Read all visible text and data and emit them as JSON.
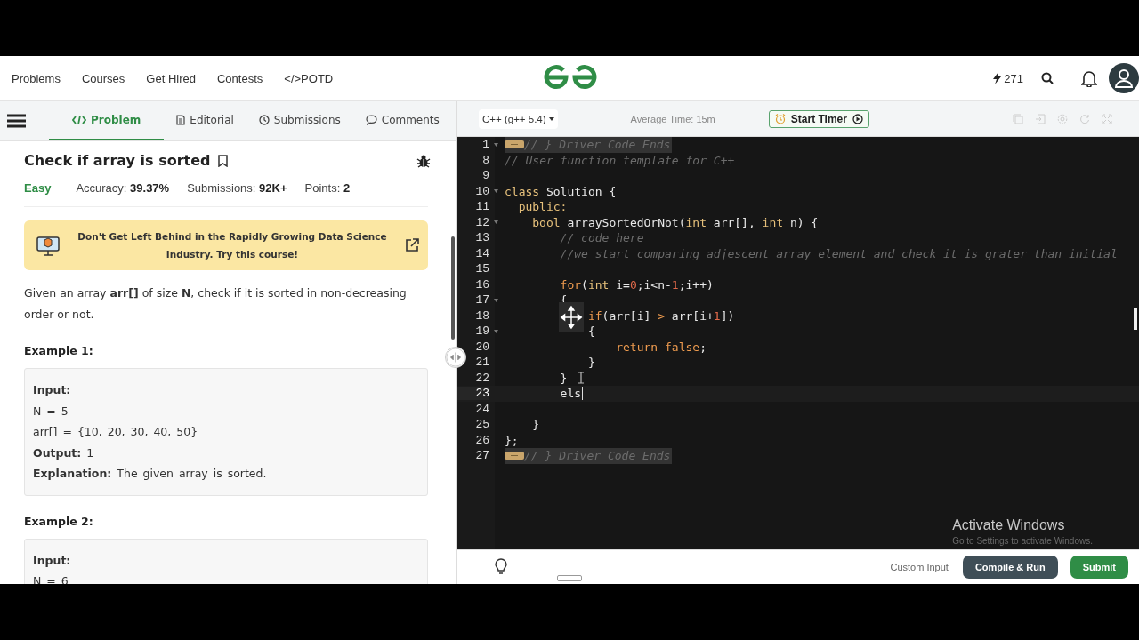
{
  "nav": {
    "links": [
      "Problems",
      "Courses",
      "Get Hired",
      "Contests",
      "</>POTD"
    ],
    "streak": "271"
  },
  "problem_tabs": [
    {
      "label": "Problem",
      "kind": "code",
      "selected": true
    },
    {
      "label": "Editorial",
      "kind": "document",
      "selected": false
    },
    {
      "label": "Submissions",
      "kind": "clock",
      "selected": false
    },
    {
      "label": "Comments",
      "kind": "comment",
      "selected": false
    }
  ],
  "problem": {
    "title": "Check if array is sorted",
    "difficulty": "Easy",
    "stats": [
      {
        "label": "Accuracy:",
        "value": "39.37%"
      },
      {
        "label": "Submissions:",
        "value": "92K+"
      },
      {
        "label": "Points:",
        "value": "2"
      }
    ],
    "banner": "Don't Get Left Behind in the Rapidly Growing Data Science Industry. Try this course!",
    "description": "Given an array **arr[]** of size **N**, check if it is sorted in non-decreasing order or not.",
    "examples": [
      {
        "title": "Example 1:",
        "lines": [
          "**Input:**",
          "N = 5",
          "arr[] = {10, 20, 30, 40, 50}",
          "**Output:** 1",
          "**Explanation:** The given array is sorted."
        ]
      },
      {
        "title": "Example 2:",
        "lines": [
          "**Input:**",
          "N = 6"
        ]
      }
    ]
  },
  "editor": {
    "language": "C++ (g++ 5.4)",
    "average_time": "Average Time: 15m",
    "timer_button": "Start Timer",
    "lines": [
      {
        "number": "1",
        "foldable": true,
        "folded": true,
        "active": false,
        "tokens": [
          {
            "kind": "comment",
            "text": "// } Driver Code Ends"
          }
        ]
      },
      {
        "number": "8",
        "foldable": false,
        "folded": false,
        "active": false,
        "tokens": [
          {
            "kind": "comment",
            "text": "// User function template for C++"
          }
        ]
      },
      {
        "number": "9",
        "foldable": false,
        "folded": false,
        "active": false
      },
      {
        "number": "10",
        "foldable": true,
        "folded": false,
        "active": false,
        "tokens": [
          {
            "kind": "keyword",
            "text": "class"
          },
          {
            "kind": "plain",
            "text": " Solution {"
          }
        ]
      },
      {
        "number": "11",
        "foldable": false,
        "folded": false,
        "active": false,
        "tokens": [
          {
            "kind": "keyword",
            "text": "  public:"
          }
        ]
      },
      {
        "number": "12",
        "foldable": true,
        "folded": false,
        "active": false,
        "tokens": [
          {
            "kind": "keyword",
            "text": "    bool"
          },
          {
            "kind": "plain",
            "text": " arraySortedOrNot("
          },
          {
            "kind": "keyword",
            "text": "int"
          },
          {
            "kind": "plain",
            "text": " arr[], "
          },
          {
            "kind": "keyword",
            "text": "int"
          },
          {
            "kind": "plain",
            "text": " n) {"
          }
        ]
      },
      {
        "number": "13",
        "foldable": false,
        "folded": false,
        "active": false,
        "tokens": [
          {
            "kind": "comment",
            "text": "        // code here"
          }
        ]
      },
      {
        "number": "14",
        "foldable": false,
        "folded": false,
        "active": false,
        "tokens": [
          {
            "kind": "comment",
            "text": "        //we start comparing adjescent array element and check it is grater than initial"
          }
        ]
      },
      {
        "number": "15",
        "foldable": false,
        "folded": false,
        "active": false
      },
      {
        "number": "16",
        "foldable": false,
        "folded": false,
        "active": false,
        "tokens": [
          {
            "kind": "control",
            "text": "        for"
          },
          {
            "kind": "plain",
            "text": "("
          },
          {
            "kind": "keyword",
            "text": "int"
          },
          {
            "kind": "plain",
            "text": " i="
          },
          {
            "kind": "number",
            "text": "0"
          },
          {
            "kind": "plain",
            "text": ";i<n-"
          },
          {
            "kind": "number",
            "text": "1"
          },
          {
            "kind": "plain",
            "text": ";i++)"
          }
        ]
      },
      {
        "number": "17",
        "foldable": true,
        "folded": false,
        "active": false,
        "tokens": [
          {
            "kind": "plain",
            "text": "        {"
          }
        ]
      },
      {
        "number": "18",
        "foldable": false,
        "folded": false,
        "active": false,
        "tokens": [
          {
            "kind": "control",
            "text": "            if"
          },
          {
            "kind": "plain",
            "text": "(arr[i] "
          },
          {
            "kind": "control",
            "text": ">"
          },
          {
            "kind": "plain",
            "text": " arr[i+"
          },
          {
            "kind": "number",
            "text": "1"
          },
          {
            "kind": "plain",
            "text": "])"
          }
        ]
      },
      {
        "number": "19",
        "foldable": true,
        "folded": false,
        "active": false,
        "tokens": [
          {
            "kind": "plain",
            "text": "            {"
          }
        ]
      },
      {
        "number": "20",
        "foldable": false,
        "folded": false,
        "active": false,
        "tokens": [
          {
            "kind": "control",
            "text": "                return"
          },
          {
            "kind": "control",
            "text": " false"
          },
          {
            "kind": "plain",
            "text": ";"
          }
        ]
      },
      {
        "number": "21",
        "foldable": false,
        "folded": false,
        "active": false,
        "tokens": [
          {
            "kind": "plain",
            "text": "            }"
          }
        ]
      },
      {
        "number": "22",
        "foldable": false,
        "folded": false,
        "active": false,
        "tokens": [
          {
            "kind": "plain",
            "text": "        }"
          }
        ]
      },
      {
        "number": "23",
        "foldable": false,
        "folded": false,
        "active": true,
        "tokens": [
          {
            "kind": "plain",
            "text": "        els"
          }
        ]
      },
      {
        "number": "24",
        "foldable": false,
        "folded": false,
        "active": false
      },
      {
        "number": "25",
        "foldable": false,
        "folded": false,
        "active": false,
        "tokens": [
          {
            "kind": "plain",
            "text": "    }"
          }
        ]
      },
      {
        "number": "26",
        "foldable": false,
        "folded": false,
        "active": false,
        "tokens": [
          {
            "kind": "plain",
            "text": "};"
          }
        ]
      },
      {
        "number": "27",
        "foldable": false,
        "folded": true,
        "active": false,
        "tokens": [
          {
            "kind": "comment",
            "text": "// } Driver Code Ends"
          }
        ]
      }
    ]
  },
  "os_notice": {
    "title": "Activate Windows",
    "subtitle": "Go to Settings to activate Windows."
  },
  "footer": {
    "custom_input": "Custom Input",
    "compile": "Compile & Run",
    "submit": "Submit"
  }
}
